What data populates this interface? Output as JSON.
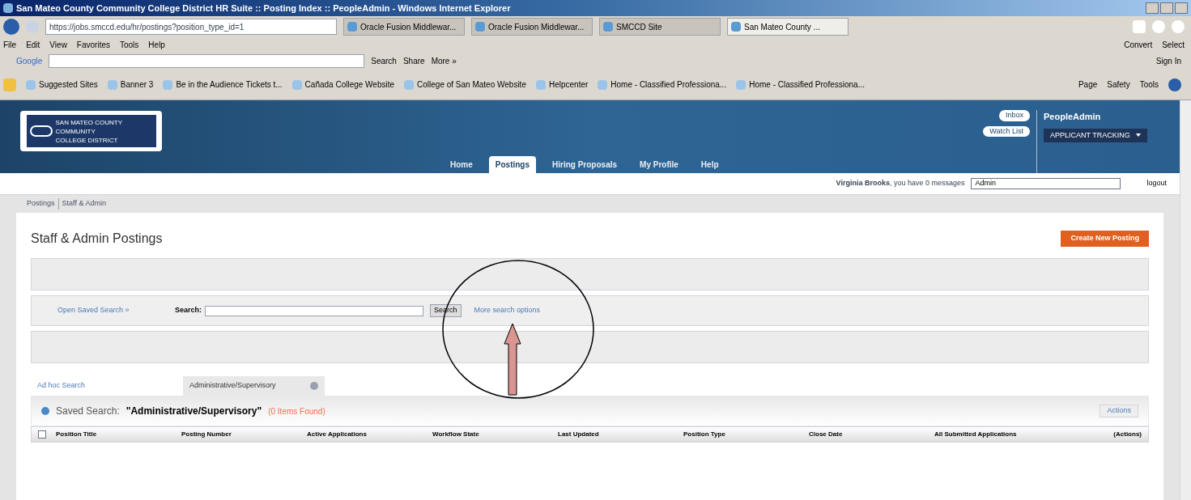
{
  "window": {
    "title": "San Mateo County Community College District HR Suite :: Posting Index :: PeopleAdmin - Windows Internet Explorer"
  },
  "address_bar": {
    "url": "https://jobs.smccd.edu/hr/postings?position_type_id=1"
  },
  "browser_tabs": [
    {
      "label": "Oracle Fusion Middlewar...",
      "selected": false
    },
    {
      "label": "Oracle Fusion Middlewar...",
      "selected": false
    },
    {
      "label": "SMCCD Site",
      "selected": false
    },
    {
      "label": "San Mateo County ...",
      "selected": true
    }
  ],
  "menu": [
    "File",
    "Edit",
    "View",
    "Favorites",
    "Tools",
    "Help"
  ],
  "google_toolbar": {
    "label": "Google",
    "items": [
      "Search",
      "Share",
      "More »"
    ],
    "right": [
      "Convert",
      "Select"
    ],
    "sign_in": "Sign In"
  },
  "favorites": [
    {
      "label": "Suggested Sites"
    },
    {
      "label": "Banner 3"
    },
    {
      "label": "Be in the Audience Tickets t..."
    },
    {
      "label": "Cañada College Website"
    },
    {
      "label": "College of San Mateo Website"
    },
    {
      "label": "Helpcenter"
    },
    {
      "label": "Home - Classified Professiona..."
    },
    {
      "label": "Home - Classified Professiona..."
    }
  ],
  "command_bar": [
    "Page",
    "Safety",
    "Tools"
  ],
  "header": {
    "logo_lines": [
      "SAN MATEO COUNTY",
      "COMMUNITY",
      "COLLEGE DISTRICT"
    ],
    "inbox": "Inbox",
    "watch_list": "Watch List",
    "brand": "PeopleAdmin",
    "module": "APPLICANT TRACKING"
  },
  "nav": [
    {
      "label": "Home",
      "selected": false
    },
    {
      "label": "Postings",
      "selected": true
    },
    {
      "label": "Hiring Proposals",
      "selected": false
    },
    {
      "label": "My Profile",
      "selected": false
    },
    {
      "label": "Help",
      "selected": false
    }
  ],
  "user_bar": {
    "name": "Virginia Brooks",
    "message": ", you have 0 messages",
    "role": "Admin",
    "logout": "logout"
  },
  "breadcrumb": [
    "Postings",
    "Staff & Admin"
  ],
  "page_title": "Staff & Admin Postings",
  "create_button": "Create New Posting",
  "search": {
    "saved_link": "Open Saved Search »",
    "label": "Search:",
    "button": "Search",
    "more": "More search options"
  },
  "search_tabs": [
    {
      "label": "Ad hoc Search",
      "selected": false
    },
    {
      "label": "Administrative/Supervisory",
      "selected": true
    }
  ],
  "saved_search": {
    "label": "Saved Search:",
    "name": "\"Administrative/Supervisory\"",
    "count": "(0 Items Found)",
    "actions": "Actions"
  },
  "table": {
    "select_all": false,
    "columns": [
      "Position Title",
      "Posting Number",
      "Active Applications",
      "Workflow State",
      "Last Updated",
      "Position Type",
      "Close Date",
      "All Submitted Applications",
      "(Actions)"
    ]
  }
}
